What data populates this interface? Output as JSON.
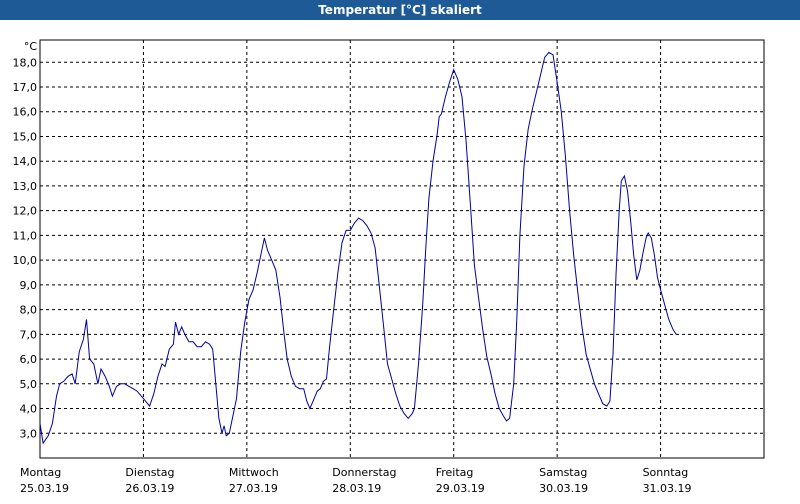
{
  "title": "Temperatur [°C] skaliert",
  "chart_data": {
    "type": "line",
    "unit": "°C",
    "y_ticks": [
      "3,0",
      "4,0",
      "5,0",
      "6,0",
      "7,0",
      "8,0",
      "9,0",
      "10,0",
      "11,0",
      "12,0",
      "13,0",
      "14,0",
      "15,0",
      "16,0",
      "17,0",
      "18,0"
    ],
    "ylim": [
      2.0,
      18.9
    ],
    "xlim": [
      0,
      7
    ],
    "grid": true,
    "line_color": "#0000a0",
    "days": [
      {
        "day": "Montag",
        "date": "25.03.19"
      },
      {
        "day": "Dienstag",
        "date": "26.03.19"
      },
      {
        "day": "Mittwoch",
        "date": "27.03.19"
      },
      {
        "day": "Donnerstag",
        "date": "28.03.19"
      },
      {
        "day": "Freitag",
        "date": "29.03.19"
      },
      {
        "day": "Samstag",
        "date": "30.03.19"
      },
      {
        "day": "Sonntag",
        "date": "31.03.19"
      }
    ],
    "series": [
      {
        "points": [
          [
            0.0,
            3.4
          ],
          [
            0.03,
            2.6
          ],
          [
            0.08,
            2.9
          ],
          [
            0.12,
            3.4
          ],
          [
            0.16,
            4.5
          ],
          [
            0.19,
            5.0
          ],
          [
            0.23,
            5.1
          ],
          [
            0.27,
            5.3
          ],
          [
            0.31,
            5.4
          ],
          [
            0.34,
            5.0
          ],
          [
            0.38,
            6.3
          ],
          [
            0.42,
            6.8
          ],
          [
            0.45,
            7.6
          ],
          [
            0.48,
            6.0
          ],
          [
            0.52,
            5.8
          ],
          [
            0.56,
            5.0
          ],
          [
            0.59,
            5.6
          ],
          [
            0.63,
            5.3
          ],
          [
            0.67,
            4.9
          ],
          [
            0.7,
            4.5
          ],
          [
            0.74,
            4.9
          ],
          [
            0.78,
            5.0
          ],
          [
            0.82,
            5.0
          ],
          [
            0.86,
            4.9
          ],
          [
            0.9,
            4.8
          ],
          [
            0.94,
            4.7
          ],
          [
            0.98,
            4.5
          ],
          [
            1.02,
            4.3
          ],
          [
            1.06,
            4.1
          ],
          [
            1.1,
            4.6
          ],
          [
            1.14,
            5.3
          ],
          [
            1.18,
            5.8
          ],
          [
            1.21,
            5.7
          ],
          [
            1.25,
            6.4
          ],
          [
            1.29,
            6.6
          ],
          [
            1.31,
            7.5
          ],
          [
            1.34,
            7.0
          ],
          [
            1.37,
            7.3
          ],
          [
            1.4,
            7.0
          ],
          [
            1.44,
            6.7
          ],
          [
            1.48,
            6.7
          ],
          [
            1.52,
            6.5
          ],
          [
            1.56,
            6.5
          ],
          [
            1.6,
            6.7
          ],
          [
            1.64,
            6.6
          ],
          [
            1.67,
            6.4
          ],
          [
            1.7,
            5.0
          ],
          [
            1.73,
            3.6
          ],
          [
            1.76,
            3.0
          ],
          [
            1.78,
            3.3
          ],
          [
            1.8,
            2.9
          ],
          [
            1.83,
            3.0
          ],
          [
            1.86,
            3.6
          ],
          [
            1.9,
            4.4
          ],
          [
            1.94,
            6.3
          ],
          [
            1.98,
            7.5
          ],
          [
            2.02,
            8.4
          ],
          [
            2.06,
            8.8
          ],
          [
            2.1,
            9.5
          ],
          [
            2.14,
            10.3
          ],
          [
            2.17,
            10.9
          ],
          [
            2.2,
            10.4
          ],
          [
            2.24,
            10.0
          ],
          [
            2.28,
            9.6
          ],
          [
            2.32,
            8.5
          ],
          [
            2.36,
            7.0
          ],
          [
            2.39,
            6.0
          ],
          [
            2.43,
            5.3
          ],
          [
            2.47,
            4.9
          ],
          [
            2.51,
            4.8
          ],
          [
            2.55,
            4.8
          ],
          [
            2.58,
            4.3
          ],
          [
            2.61,
            4.0
          ],
          [
            2.64,
            4.3
          ],
          [
            2.68,
            4.7
          ],
          [
            2.71,
            4.8
          ],
          [
            2.74,
            5.1
          ],
          [
            2.77,
            5.2
          ],
          [
            2.8,
            6.5
          ],
          [
            2.84,
            8.0
          ],
          [
            2.88,
            9.5
          ],
          [
            2.92,
            10.7
          ],
          [
            2.96,
            11.2
          ],
          [
            3.0,
            11.2
          ],
          [
            3.04,
            11.5
          ],
          [
            3.08,
            11.7
          ],
          [
            3.12,
            11.6
          ],
          [
            3.16,
            11.4
          ],
          [
            3.2,
            11.1
          ],
          [
            3.24,
            10.5
          ],
          [
            3.28,
            9.0
          ],
          [
            3.32,
            7.4
          ],
          [
            3.36,
            5.8
          ],
          [
            3.4,
            5.2
          ],
          [
            3.44,
            4.6
          ],
          [
            3.48,
            4.1
          ],
          [
            3.52,
            3.8
          ],
          [
            3.56,
            3.6
          ],
          [
            3.6,
            3.8
          ],
          [
            3.62,
            4.0
          ],
          [
            3.66,
            5.8
          ],
          [
            3.7,
            8.2
          ],
          [
            3.73,
            10.5
          ],
          [
            3.76,
            12.5
          ],
          [
            3.8,
            14.0
          ],
          [
            3.84,
            15.1
          ],
          [
            3.86,
            15.8
          ],
          [
            3.88,
            15.9
          ],
          [
            3.92,
            16.6
          ],
          [
            3.96,
            17.2
          ],
          [
            4.0,
            17.7
          ],
          [
            4.04,
            17.3
          ],
          [
            4.08,
            16.6
          ],
          [
            4.12,
            14.8
          ],
          [
            4.16,
            12.3
          ],
          [
            4.2,
            9.8
          ],
          [
            4.24,
            8.5
          ],
          [
            4.28,
            7.2
          ],
          [
            4.32,
            6.1
          ],
          [
            4.36,
            5.4
          ],
          [
            4.4,
            4.6
          ],
          [
            4.44,
            4.0
          ],
          [
            4.48,
            3.7
          ],
          [
            4.51,
            3.5
          ],
          [
            4.54,
            3.6
          ],
          [
            4.58,
            5.0
          ],
          [
            4.61,
            7.6
          ],
          [
            4.64,
            11.0
          ],
          [
            4.68,
            13.8
          ],
          [
            4.72,
            15.3
          ],
          [
            4.76,
            16.1
          ],
          [
            4.8,
            16.8
          ],
          [
            4.84,
            17.5
          ],
          [
            4.88,
            18.2
          ],
          [
            4.92,
            18.4
          ],
          [
            4.96,
            18.3
          ],
          [
            5.0,
            17.2
          ],
          [
            5.04,
            16.0
          ],
          [
            5.08,
            14.2
          ],
          [
            5.12,
            12.0
          ],
          [
            5.16,
            10.2
          ],
          [
            5.2,
            8.7
          ],
          [
            5.24,
            7.3
          ],
          [
            5.28,
            6.2
          ],
          [
            5.32,
            5.6
          ],
          [
            5.36,
            5.0
          ],
          [
            5.4,
            4.6
          ],
          [
            5.44,
            4.2
          ],
          [
            5.48,
            4.1
          ],
          [
            5.51,
            4.3
          ],
          [
            5.54,
            6.2
          ],
          [
            5.57,
            9.5
          ],
          [
            5.6,
            12.0
          ],
          [
            5.62,
            13.2
          ],
          [
            5.65,
            13.4
          ],
          [
            5.68,
            12.8
          ],
          [
            5.71,
            11.6
          ],
          [
            5.74,
            10.2
          ],
          [
            5.77,
            9.2
          ],
          [
            5.8,
            9.6
          ],
          [
            5.83,
            10.3
          ],
          [
            5.86,
            10.9
          ],
          [
            5.88,
            11.1
          ],
          [
            5.91,
            10.9
          ],
          [
            5.94,
            10.2
          ],
          [
            5.97,
            9.3
          ],
          [
            6.0,
            8.8
          ],
          [
            6.04,
            8.2
          ],
          [
            6.08,
            7.6
          ],
          [
            6.12,
            7.2
          ],
          [
            6.15,
            7.0
          ]
        ]
      }
    ]
  }
}
